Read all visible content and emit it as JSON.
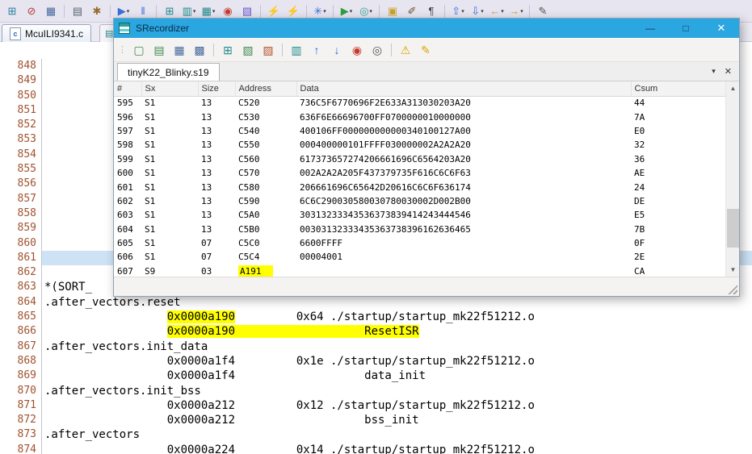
{
  "main_toolbar": {
    "caret_glyph": "▾",
    "icons": [
      {
        "name": "new-wizard-icon",
        "glyph": "⊞",
        "color": "#2b7fa0"
      },
      {
        "name": "skip-breakpoints-icon",
        "glyph": "⊘",
        "color": "#b33a3a"
      },
      {
        "name": "save-icon",
        "glyph": "▦",
        "color": "#44699d"
      },
      {
        "sep": true
      },
      {
        "name": "print-icon",
        "glyph": "▤",
        "color": "#5a6572"
      },
      {
        "name": "build-icon",
        "glyph": "✱",
        "color": "#9a6a2f"
      },
      {
        "sep": true
      },
      {
        "name": "resume-icon",
        "glyph": "▶",
        "color": "#3a6fd8",
        "caret": true
      },
      {
        "name": "suspend-icon",
        "glyph": "‖",
        "color": "#3a6fd8"
      },
      {
        "sep": true
      },
      {
        "name": "table-view-icon",
        "glyph": "⊞",
        "color": "#1f8a8a"
      },
      {
        "name": "memory-view-icon",
        "glyph": "▥",
        "color": "#1f8a8a",
        "caret": true
      },
      {
        "name": "register-view-icon",
        "glyph": "▦",
        "color": "#1f8a8a",
        "caret": true
      },
      {
        "name": "record-icon",
        "glyph": "◉",
        "color": "#c63a2f"
      },
      {
        "name": "chart-icon",
        "glyph": "▧",
        "color": "#6a5acd"
      },
      {
        "sep": true
      },
      {
        "name": "flash-program-icon",
        "glyph": "⚡",
        "color": "#d23b2f"
      },
      {
        "name": "flash-erase-icon",
        "glyph": "⚡",
        "color": "#d23b2f"
      },
      {
        "sep": true
      },
      {
        "name": "debug-config-icon",
        "glyph": "✳",
        "color": "#3a6fd8",
        "caret": true
      },
      {
        "sep": true
      },
      {
        "name": "run-icon",
        "glyph": "▶",
        "color": "#2e9e3f",
        "caret": true
      },
      {
        "name": "external-tools-icon",
        "glyph": "◎",
        "color": "#2e9e8f",
        "caret": true
      },
      {
        "sep": true
      },
      {
        "name": "open-type-icon",
        "glyph": "▣",
        "color": "#c9a227"
      },
      {
        "name": "annotate-icon",
        "glyph": "✐",
        "color": "#6b4f2a"
      },
      {
        "name": "show-whitespace-icon",
        "glyph": "¶",
        "color": "#444444"
      },
      {
        "sep": true
      },
      {
        "name": "last-edit-location-icon",
        "glyph": "⇧",
        "color": "#3a6fd8",
        "caret": true
      },
      {
        "name": "next-annotation-icon",
        "glyph": "⇩",
        "color": "#3a6fd8",
        "caret": true
      },
      {
        "name": "back-icon",
        "glyph": "←",
        "color": "#c9a227",
        "caret": true
      },
      {
        "name": "forward-icon",
        "glyph": "→",
        "color": "#c9a227",
        "caret": true
      },
      {
        "sep": true
      },
      {
        "name": "pencil-icon",
        "glyph": "✎",
        "color": "#555555"
      }
    ]
  },
  "editor": {
    "tab_label": "McuILI9341.c",
    "tab_icon_letter": "c",
    "current_line": "861",
    "lines": [
      {
        "num": "848",
        "segs": []
      },
      {
        "num": "849",
        "segs": []
      },
      {
        "num": "850",
        "segs": []
      },
      {
        "num": "851",
        "segs": []
      },
      {
        "num": "852",
        "segs": []
      },
      {
        "num": "853",
        "segs": []
      },
      {
        "num": "854",
        "segs": []
      },
      {
        "num": "855",
        "segs": []
      },
      {
        "num": "856",
        "segs": []
      },
      {
        "num": "857",
        "segs": []
      },
      {
        "num": "858",
        "segs": []
      },
      {
        "num": "859",
        "segs": []
      },
      {
        "num": "860",
        "segs": []
      },
      {
        "num": "861",
        "segs": []
      },
      {
        "num": "862",
        "segs": []
      },
      {
        "num": "863",
        "segs": [
          [
            "*(SORT_",
            0
          ]
        ]
      },
      {
        "num": "864",
        "segs": [
          [
            ".after_vectors.reset",
            0
          ]
        ]
      },
      {
        "num": "865",
        "segs": [
          [
            "                  ",
            0
          ],
          [
            "0x0000a190",
            1
          ],
          [
            "         0x64 ./startup/startup_mk22f51212.o",
            0
          ]
        ]
      },
      {
        "num": "866",
        "segs": [
          [
            "                  ",
            0
          ],
          [
            "0x0000a190                   ResetISR",
            1
          ]
        ]
      },
      {
        "num": "867",
        "segs": [
          [
            ".after_vectors.init_data",
            0
          ]
        ]
      },
      {
        "num": "868",
        "segs": [
          [
            "                  0x0000a1f4         0x1e ./startup/startup_mk22f51212.o",
            0
          ]
        ]
      },
      {
        "num": "869",
        "segs": [
          [
            "                  0x0000a1f4                   data_init",
            0
          ]
        ]
      },
      {
        "num": "870",
        "segs": [
          [
            ".after_vectors.init_bss",
            0
          ]
        ]
      },
      {
        "num": "871",
        "segs": [
          [
            "                  0x0000a212         0x12 ./startup/startup_mk22f51212.o",
            0
          ]
        ]
      },
      {
        "num": "872",
        "segs": [
          [
            "                  0x0000a212                   bss_init",
            0
          ]
        ]
      },
      {
        "num": "873",
        "segs": [
          [
            ".after_vectors",
            0
          ]
        ]
      },
      {
        "num": "874",
        "segs": [
          [
            "                  0x0000a224         0x14 ./startup/startup_mk22f51212.o",
            0
          ]
        ]
      }
    ]
  },
  "srec": {
    "title": "SRecordizer",
    "window_buttons": {
      "minimize": "—",
      "maximize": "□",
      "close": "✕"
    },
    "toolbar": {
      "icons": [
        {
          "name": "new-file-icon",
          "glyph": "▢",
          "color": "#3c8a4e"
        },
        {
          "name": "open-file-icon",
          "glyph": "▤",
          "color": "#3c8a4e"
        },
        {
          "name": "save-icon",
          "glyph": "▦",
          "color": "#44699d"
        },
        {
          "name": "save-as-icon",
          "glyph": "▩",
          "color": "#44699d"
        },
        {
          "sep": true
        },
        {
          "name": "new-table-icon",
          "glyph": "⊞",
          "color": "#1f8a8a"
        },
        {
          "name": "export-line-icon",
          "glyph": "▧",
          "color": "#3c8a4e"
        },
        {
          "name": "import-line-icon",
          "glyph": "▨",
          "color": "#b5532a"
        },
        {
          "sep": true
        },
        {
          "name": "columns-icon",
          "glyph": "▥",
          "color": "#1f8a8a"
        },
        {
          "name": "move-up-icon",
          "glyph": "↑",
          "color": "#2f6fd6"
        },
        {
          "name": "move-down-icon",
          "glyph": "↓",
          "color": "#2f6fd6"
        },
        {
          "name": "record-icon",
          "glyph": "◉",
          "color": "#c63a2f"
        },
        {
          "name": "preview-eye-icon",
          "glyph": "◎",
          "color": "#555555"
        },
        {
          "sep": true
        },
        {
          "name": "validate-warning-icon",
          "glyph": "⚠",
          "color": "#d9a400"
        },
        {
          "name": "edit-pencil-icon",
          "glyph": "✎",
          "color": "#d9a400"
        }
      ]
    },
    "tab_label": "tinyK22_Blinky.s19",
    "tab_chevron": "▾",
    "tab_close": "✕",
    "scrollbar": {
      "up": "▲",
      "down": "▼"
    },
    "table": {
      "columns": [
        "#",
        "Sx",
        "Size",
        "Address",
        "Data",
        "Csum"
      ],
      "rows": [
        [
          "595",
          "S1",
          "13",
          "C520",
          "736C5F6770696F2E633A313030203A20",
          "44"
        ],
        [
          "596",
          "S1",
          "13",
          "C530",
          "636F6E66696700FF0700000010000000",
          "7A"
        ],
        [
          "597",
          "S1",
          "13",
          "C540",
          "400106FF000000000000340100127A00",
          "E0"
        ],
        [
          "598",
          "S1",
          "13",
          "C550",
          "000400000101FFFF030000002A2A2A20",
          "32"
        ],
        [
          "599",
          "S1",
          "13",
          "C560",
          "617373657274206661696C6564203A20",
          "36"
        ],
        [
          "600",
          "S1",
          "13",
          "C570",
          "002A2A2A205F437379735F616C6C6F63",
          "AE"
        ],
        [
          "601",
          "S1",
          "13",
          "C580",
          "206661696C65642D20616C6C6F636174",
          "24"
        ],
        [
          "602",
          "S1",
          "13",
          "C590",
          "6C6C290030580030780030002D002B00",
          "DE"
        ],
        [
          "603",
          "S1",
          "13",
          "C5A0",
          "30313233343536373839414243444546",
          "E5"
        ],
        [
          "604",
          "S1",
          "13",
          "C5B0",
          "00303132333435363738396162636465",
          "7B"
        ],
        [
          "605",
          "S1",
          "07",
          "C5C0",
          "6600FFFF",
          "0F"
        ],
        [
          "606",
          "S1",
          "07",
          "C5C4",
          "00004001",
          "2E"
        ],
        [
          "607",
          "S9",
          "03",
          "A191",
          "",
          "CA"
        ]
      ],
      "highlight": {
        "row": "607",
        "column": "Address",
        "color": "#ffff00"
      }
    }
  }
}
